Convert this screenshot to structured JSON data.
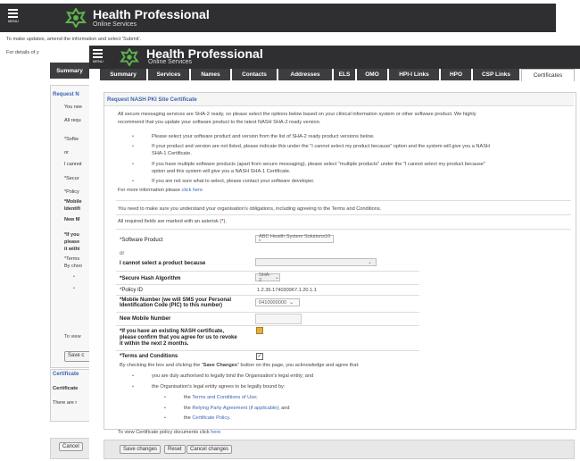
{
  "back": {
    "header": {
      "menu_label": "MENU",
      "brand_title": "Health Professional",
      "brand_sub": "Online Services"
    },
    "intro_text": "To make updates, amend the information and select 'Submit'.",
    "details_text": "For details of y",
    "tab_summary": "Summary",
    "side_title": "Request N",
    "side_lines": [
      "You nee",
      "All requ",
      "*Softw",
      "or",
      "I cannot",
      "*Secur",
      "*Policy",
      "*Mobile",
      "Identifi",
      "New M",
      "*If you",
      "please",
      "it withi",
      "*Terms",
      "By choo"
    ],
    "to_view": "To view",
    "save_btn": "Save c",
    "certificate_title": "Certificate",
    "certificate_tab": "Certificate",
    "there_are": "There are r",
    "cancel_btn": "Cancel"
  },
  "front": {
    "header": {
      "menu_label": "MENU",
      "brand_title": "Health Professional",
      "brand_sub": "Online Services"
    },
    "tabs": [
      "Summary",
      "Services",
      "Names",
      "Contacts",
      "Addresses",
      "ELS",
      "OMO",
      "HPI-I Links",
      "HPO",
      "CSP Links",
      "Certificates"
    ],
    "panel_title": "Request NASH PKI Site Certificate",
    "intro_1": "All secure messaging services are SHA-2 ready, so please select the options below based on your clinical information system or other software product. We highly",
    "intro_2": "recommend that you update your software product to the latest NASH SHA-2 ready version.",
    "bullets": [
      "Please select your software product and version from the list of SHA-2 ready product versions below.",
      "If your product and version are not listed, please indicate this under the \"I cannot select my product because\" option and the system will give you a NASH",
      "SHA-1 Certificate.",
      "If you have multiple software products (apart from secure messaging), please select \"multiple products\" under the \"I cannot select my product because\"",
      "option and this system will give you a NASH SHA-1 Certificate.",
      "If you are not sure what to select, please contact your software developer."
    ],
    "more_info_prefix": "For more information please ",
    "more_info_link": "click here",
    "obligations": "You need to make sure you understand your organisation's obligations, including agreeing to the Terms and Conditions.",
    "required_note": "All required fields are marked with an asterisk (",
    "required_star": "*",
    "required_close": ").",
    "form": {
      "software_label": "*Software Product",
      "software_value": "ABC Health System Solutions10 *",
      "or": "or",
      "cannot_label": "I cannot select a product because",
      "hash_label": "*Secure Hash Algorithm",
      "hash_value": "SHA-2",
      "policy_label": "*Policy ID",
      "policy_value": "1.2.36.174030967.1.20.1.1",
      "mobile_label_1": "*Mobile Number (we will SMS your Personal",
      "mobile_label_2": "Identification Code (PIC) to this number)",
      "mobile_value": "0410000000",
      "new_mobile_label": "New Mobile Number",
      "existing_label_1": "*If you have an existing NASH certificate,",
      "existing_label_2": "please confirm that you agree for us to revoke",
      "existing_label_3": "it within the next 2 months.",
      "terms_label": "*Terms and Conditions"
    },
    "agree_prefix": "By checking the box and clicking the \"",
    "agree_bold": "Save Changes",
    "agree_suffix": "\" button on this page, you acknowledge and agree that:",
    "agree_items": [
      "you are duly authorised to legally bind the Organisation's legal entity; and",
      "the Organisation's legal entity agrees to be legally bound by:"
    ],
    "sub_items": [
      {
        "prefix": "the ",
        "link": "Terms and Conditions of Use",
        "suffix": ";"
      },
      {
        "prefix": "the ",
        "link": "Relying Party Agreement (if applicable)",
        "suffix": "; and"
      },
      {
        "prefix": "the ",
        "link": "Certificate Policy",
        "suffix": "."
      }
    ],
    "policy_docs_prefix": "To view Certificate policy documents click ",
    "policy_docs_link": "here",
    "buttons": {
      "save": "Save changes",
      "reset": "Reset",
      "cancel": "Cancel changes"
    }
  },
  "colors": {
    "header_bg": "#2f2f32",
    "link": "#3c64b4",
    "panel_title": "#3c64b4",
    "checkbox_checked": "#e0b040"
  }
}
